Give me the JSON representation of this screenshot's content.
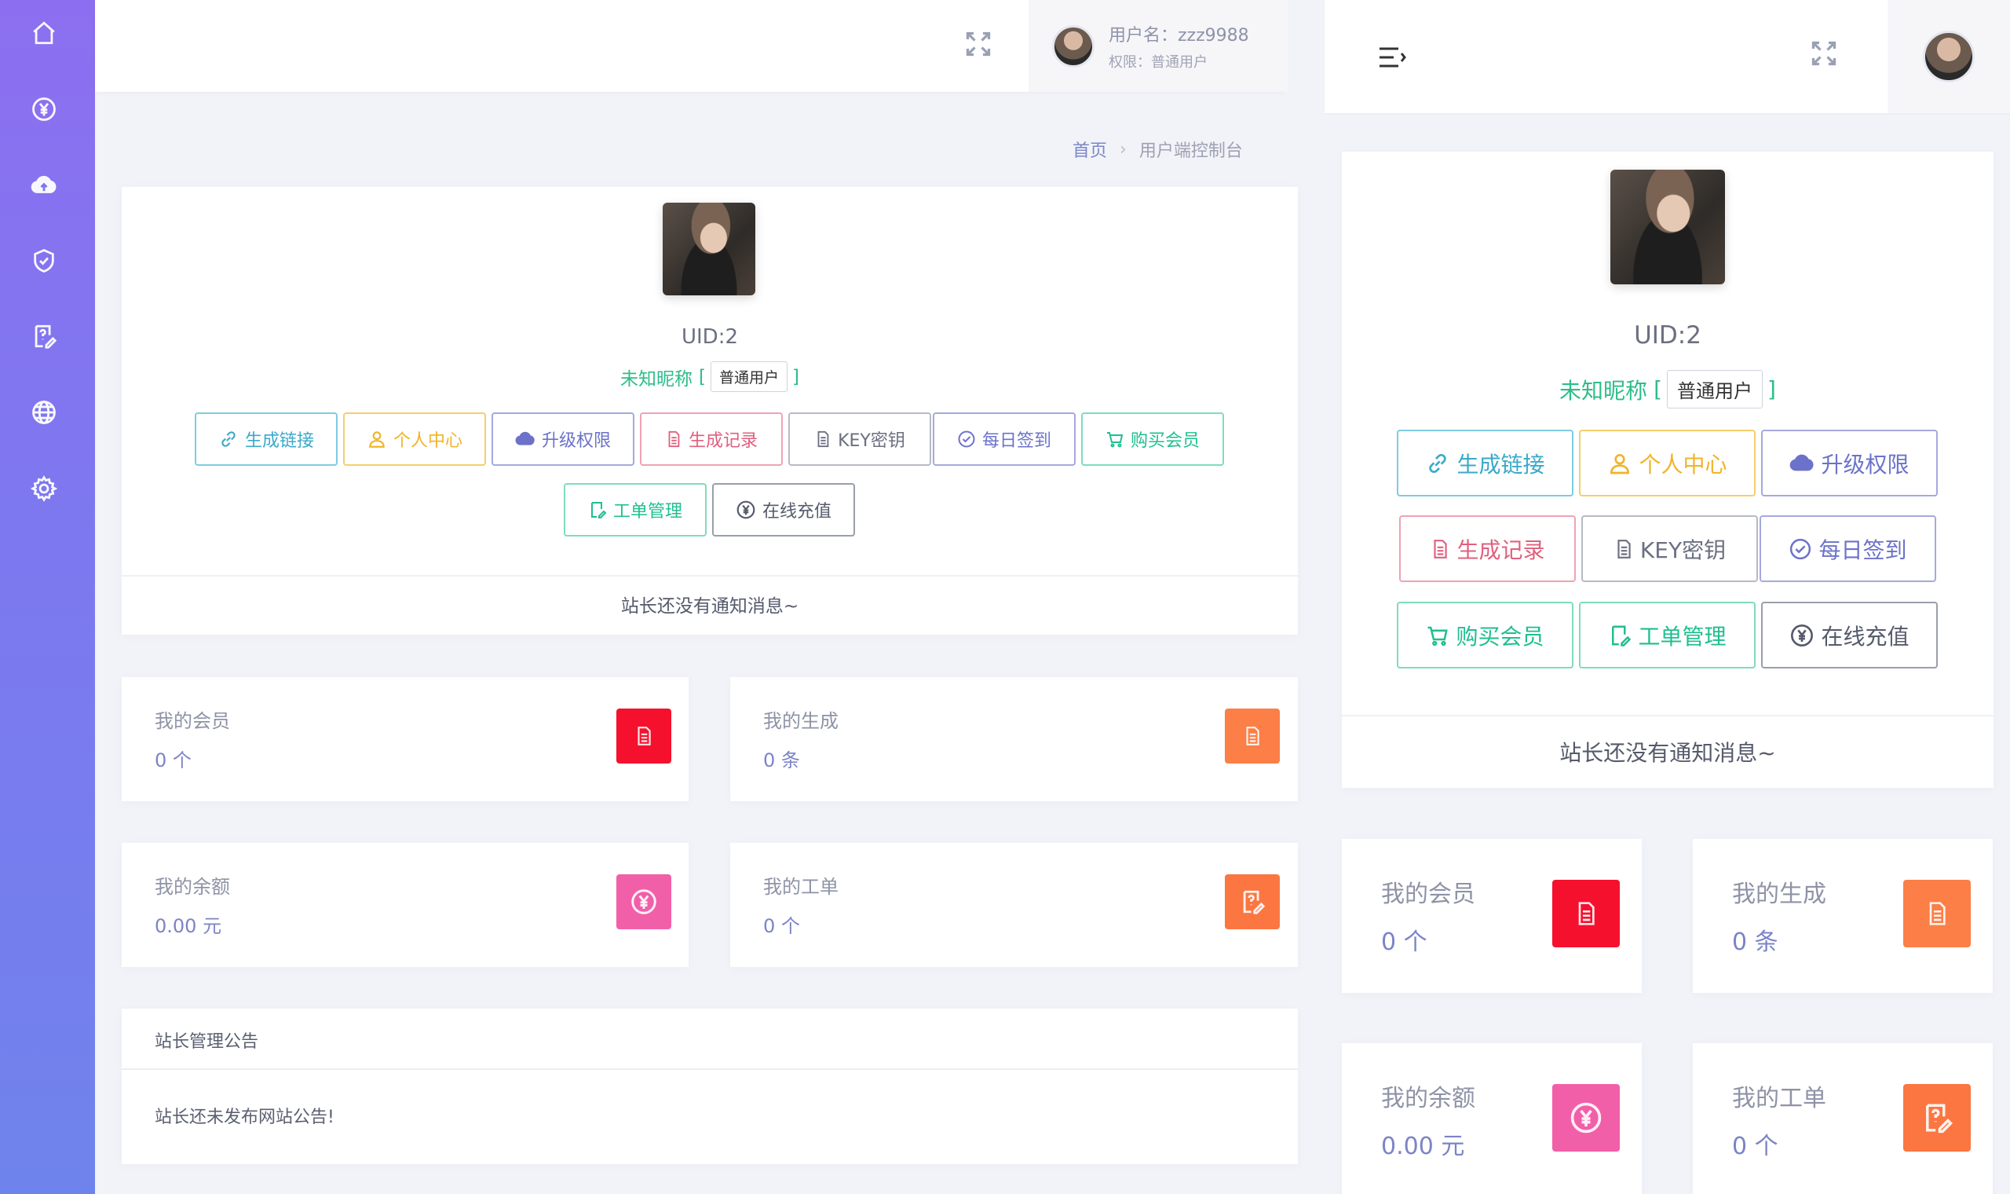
{
  "sidebar": {
    "icons": [
      "home-icon",
      "yuan-icon",
      "cloud-upload-icon",
      "shield-check-icon",
      "ticket-icon",
      "globe-icon",
      "gear-icon"
    ]
  },
  "header": {
    "username": "用户名：zzz9988",
    "permission": "权限：普通用户"
  },
  "breadcrumb": {
    "home": "首页",
    "separator": "›",
    "current": "用户端控制台"
  },
  "profile": {
    "uid": "UID:2",
    "nickname": "未知昵称",
    "bracket_open": "[",
    "bracket_close": "]",
    "role_tag": "普通用户"
  },
  "actions": [
    {
      "label": "生成链接",
      "icon": "link-icon",
      "color": "#3ba9c9"
    },
    {
      "label": "个人中心",
      "icon": "user-icon",
      "color": "#f0b429"
    },
    {
      "label": "升级权限",
      "icon": "cloud-upload-icon",
      "color": "#6c72c9"
    },
    {
      "label": "生成记录",
      "icon": "document-icon",
      "color": "#e0607e"
    },
    {
      "label": "KEY密钥",
      "icon": "document-icon",
      "color": "#6b6f80"
    },
    {
      "label": "每日签到",
      "icon": "check-circle-icon",
      "color": "#6c72c9"
    },
    {
      "label": "购买会员",
      "icon": "cart-icon",
      "color": "#1fbf8f"
    },
    {
      "label": "工单管理",
      "icon": "ticket-edit-icon",
      "color": "#1fbf8f"
    },
    {
      "label": "在线充值",
      "icon": "yuan-circle-icon",
      "color": "#555a6b"
    }
  ],
  "notice": "站长还没有通知消息~",
  "stats": [
    {
      "label": "我的会员",
      "value": "0 个",
      "icon": "document-icon",
      "color": "#f5112e"
    },
    {
      "label": "我的生成",
      "value": "0 条",
      "icon": "document-icon",
      "color": "#fb7f46"
    },
    {
      "label": "我的余额",
      "value": "0.00 元",
      "icon": "yuan-circle-icon",
      "color": "#f25fa9"
    },
    {
      "label": "我的工单",
      "value": "0 个",
      "icon": "ticket-edit-icon",
      "color": "#fb7641"
    }
  ],
  "announcement": {
    "title": "站长管理公告",
    "body": "站长还未发布网站公告!"
  }
}
